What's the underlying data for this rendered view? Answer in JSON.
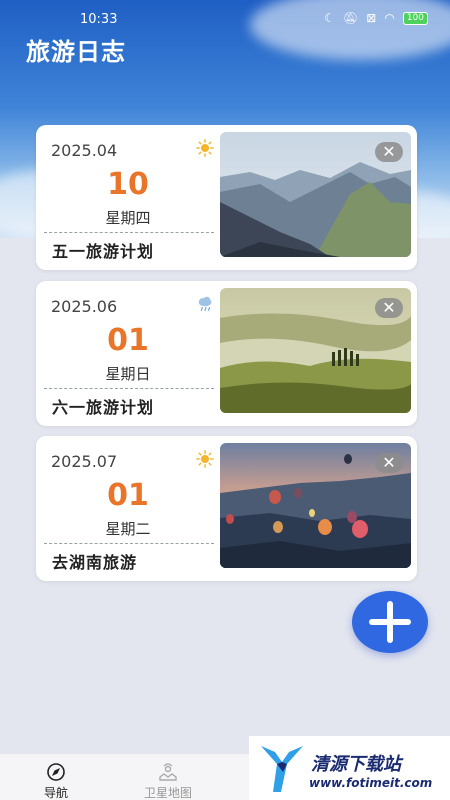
{
  "status_bar": {
    "time": "10:33",
    "battery": "100"
  },
  "app": {
    "title": "旅游日志"
  },
  "entries": [
    {
      "month": "2025.04",
      "day": "10",
      "weekday": "星期四",
      "plan": "五一旅游计划",
      "weather_icon": "sun-icon",
      "photo": "mountain-landscape",
      "close_label": "✕"
    },
    {
      "month": "2025.06",
      "day": "01",
      "weekday": "星期日",
      "plan": "六一旅游计划",
      "weather_icon": "cloud-rain-icon",
      "photo": "misty-hills-landscape",
      "close_label": "✕"
    },
    {
      "month": "2025.07",
      "day": "01",
      "weekday": "星期二",
      "plan": "去湖南旅游",
      "weather_icon": "sun-icon",
      "photo": "hot-air-balloons-landscape",
      "close_label": "✕"
    }
  ],
  "bottom_nav": {
    "items": [
      {
        "label": "导航",
        "icon": "compass-icon",
        "active": true
      },
      {
        "label": "卫星地图",
        "icon": "satellite-map-icon",
        "active": false
      }
    ]
  },
  "watermark": {
    "brand": "清源下载站",
    "url": "www.fotimeit.com"
  },
  "colors": {
    "accent": "#e8752a",
    "fab": "#2f68e0",
    "sky_top": "#1f5fc4"
  }
}
